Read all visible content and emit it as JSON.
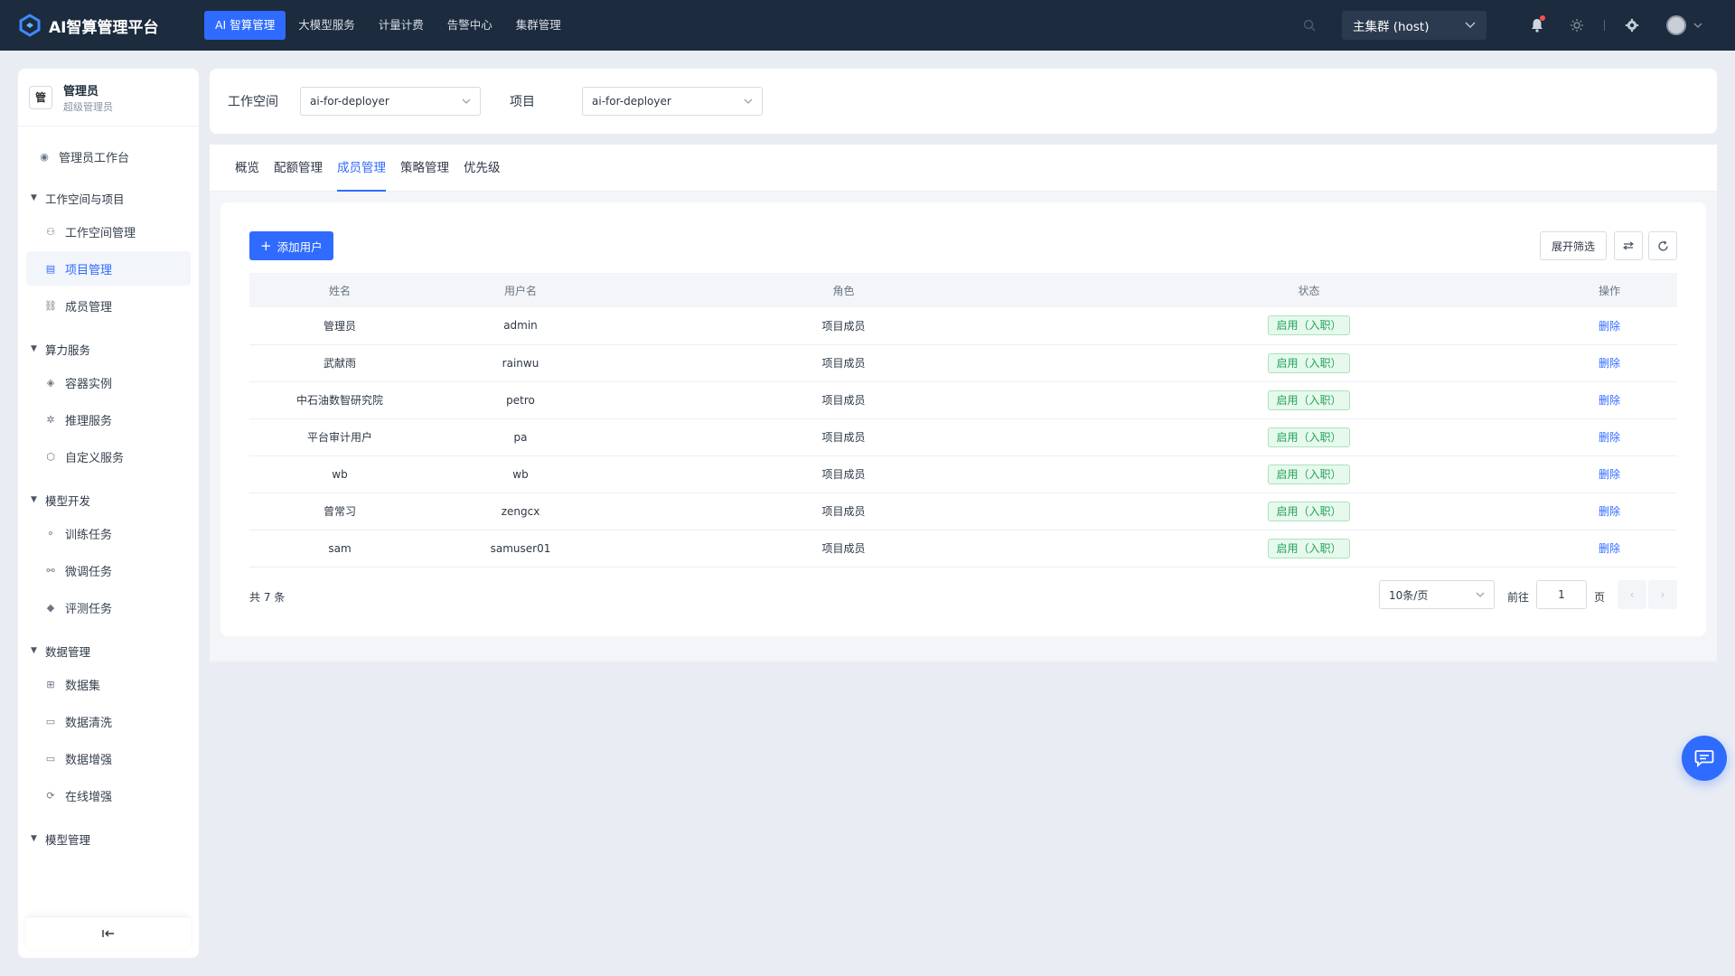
{
  "app": {
    "title": "AI智算管理平台"
  },
  "topnav": [
    {
      "label": "AI 智算管理",
      "active": true
    },
    {
      "label": "大模型服务",
      "active": false
    },
    {
      "label": "计量计费",
      "active": false
    },
    {
      "label": "告警中心",
      "active": false
    },
    {
      "label": "集群管理",
      "active": false
    }
  ],
  "cluster": {
    "selected": "主集群 (host)"
  },
  "user": {
    "avatar_text": "管",
    "name": "管理员",
    "role": "超级管理员"
  },
  "sidebar": {
    "workbench": "管理员工作台",
    "groups": [
      {
        "label": "工作空间与项目",
        "items": [
          "工作空间管理",
          "项目管理",
          "成员管理"
        ]
      },
      {
        "label": "算力服务",
        "items": [
          "容器实例",
          "推理服务",
          "自定义服务"
        ]
      },
      {
        "label": "模型开发",
        "items": [
          "训练任务",
          "微调任务",
          "评测任务"
        ]
      },
      {
        "label": "数据管理",
        "items": [
          "数据集",
          "数据清洗",
          "数据增强",
          "在线增强"
        ]
      },
      {
        "label": "模型管理",
        "items": []
      }
    ],
    "active_item": "项目管理"
  },
  "filters": {
    "workspace_label": "工作空间",
    "workspace_value": "ai-for-deployer",
    "project_label": "项目",
    "project_value": "ai-for-deployer"
  },
  "tabs": [
    {
      "label": "概览",
      "active": false
    },
    {
      "label": "配额管理",
      "active": false
    },
    {
      "label": "成员管理",
      "active": true
    },
    {
      "label": "策略管理",
      "active": false
    },
    {
      "label": "优先级",
      "active": false
    }
  ],
  "toolbar": {
    "add_user": "添加用户",
    "expand_filter": "展开筛选"
  },
  "table": {
    "columns": [
      "姓名",
      "用户名",
      "角色",
      "状态",
      "操作"
    ],
    "rows": [
      {
        "name": "管理员",
        "username": "admin",
        "role": "项目成员",
        "status": "启用（入职）",
        "action": "删除"
      },
      {
        "name": "武献雨",
        "username": "rainwu",
        "role": "项目成员",
        "status": "启用（入职）",
        "action": "删除"
      },
      {
        "name": "中石油数智研究院",
        "username": "petro",
        "role": "项目成员",
        "status": "启用（入职）",
        "action": "删除"
      },
      {
        "name": "平台审计用户",
        "username": "pa",
        "role": "项目成员",
        "status": "启用（入职）",
        "action": "删除"
      },
      {
        "name": "wb",
        "username": "wb",
        "role": "项目成员",
        "status": "启用（入职）",
        "action": "删除"
      },
      {
        "name": "曾常习",
        "username": "zengcx",
        "role": "项目成员",
        "status": "启用（入职）",
        "action": "删除"
      },
      {
        "name": "sam",
        "username": "samuser01",
        "role": "项目成员",
        "status": "启用（入职）",
        "action": "删除"
      }
    ]
  },
  "pagination": {
    "total_text": "共 7 条",
    "page_size": "10条/页",
    "goto_label": "前往",
    "current_page": "1",
    "page_unit": "页"
  },
  "colors": {
    "primary": "#2f6bff",
    "topbar": "#1c2b3e",
    "success": "#21a35a",
    "badge_dot": "#ff4d4f"
  }
}
